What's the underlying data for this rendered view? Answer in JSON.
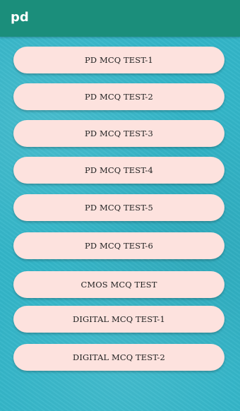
{
  "app": {
    "title": "pd"
  },
  "buttons": [
    {
      "label": "PD MCQ TEST-1"
    },
    {
      "label": "PD MCQ TEST-2"
    },
    {
      "label": "PD MCQ TEST-3"
    },
    {
      "label": "PD MCQ TEST-4"
    },
    {
      "label": "PD MCQ TEST-5"
    },
    {
      "label": "PD MCQ TEST-6"
    },
    {
      "label": "CMOS MCQ TEST"
    },
    {
      "label": "DIGITAL MCQ TEST-1"
    },
    {
      "label": "DIGITAL MCQ TEST-2"
    }
  ],
  "colors": {
    "toolbar": "#1b8e7b",
    "background": "#33b5c8",
    "button": "#fde2de",
    "button_text": "#222222",
    "title_text": "#ffffff"
  }
}
